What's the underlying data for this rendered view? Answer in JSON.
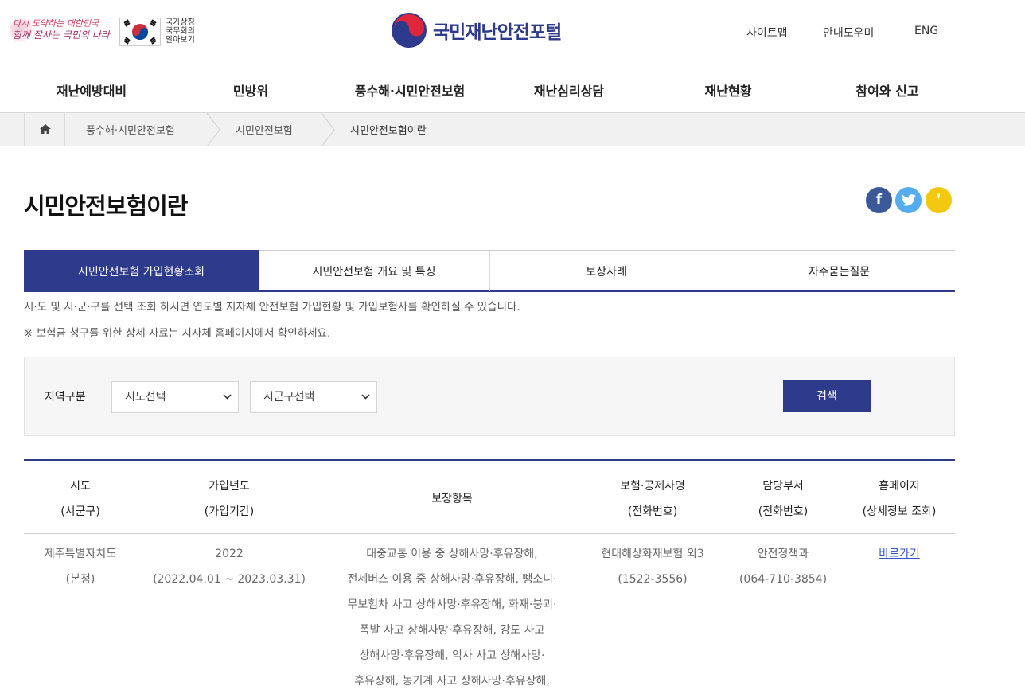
{
  "header": {
    "slogan_line1": "다시 도약하는 대한민국",
    "slogan_line2": "함께 잘사는 국민의 나라",
    "flag_text_line1": "국가상징",
    "flag_text_line2": "국무회의",
    "flag_text_line3": "알아보기",
    "site_name": "국민재난안전포털",
    "util_links": [
      "사이트맵",
      "안내도우미",
      "ENG"
    ]
  },
  "gnb": [
    "재난예방대비",
    "민방위",
    "풍수해·시민안전보험",
    "재난심리상담",
    "재난현황",
    "참여와 신고"
  ],
  "breadcrumb": [
    "풍수해·시민안전보험",
    "시민안전보험",
    "시민안전보험이란"
  ],
  "page_title": "시민안전보험이란",
  "sns": {
    "facebook": "f",
    "kakao": "❜"
  },
  "tabs": [
    "시민안전보험 가입현황조회",
    "시민안전보험 개요 및 특징",
    "보상사례",
    "자주묻는질문"
  ],
  "description": [
    "시·도 및 시·군·구를 선택 조회 하시면 연도별 지자체 안전보험 가입현황 및 가입보험사를 확인하실 수 있습니다.",
    "※ 보험금 청구를 위한 상세 자료는 지자체 홈페이지에서 확인하세요."
  ],
  "search": {
    "label": "지역구분",
    "sido_selected": "시도선택",
    "sigungu_selected": "시군구선택",
    "button": "검색"
  },
  "table": {
    "headers": [
      {
        "line1": "시도",
        "line2": "(시군구)"
      },
      {
        "line1": "가입년도",
        "line2": "(가입기간)"
      },
      {
        "line1": "보장항목",
        "line2": ""
      },
      {
        "line1": "보험·공제사명",
        "line2": "(전화번호)"
      },
      {
        "line1": "담당부서",
        "line2": "(전화번호)"
      },
      {
        "line1": "홈페이지",
        "line2": "(상세정보 조회)"
      }
    ],
    "rows": [
      {
        "sido": "제주특별자치도",
        "sigungu": "(본청)",
        "year": "2022",
        "period": "(2022.04.01 ~ 2023.03.31)",
        "coverage": [
          "대중교통 이용 중 상해사망·후유장해,",
          "전세버스 이용 중 상해사망·후유장해, 뺑소니·",
          "무보험차 사고 상해사망·후유장해, 화재·붕괴·",
          "폭발 사고 상해사망·후유장해, 강도 사고",
          "상해사망·후유장해, 익사 사고 상해사망·",
          "후유장해, 농기계 사고 상해사망·후유장해,"
        ],
        "insurer": "현대해상화재보험 외3",
        "insurer_phone": "(1522-3556)",
        "dept": "안전정책과",
        "dept_phone": "(064-710-3854)",
        "homepage": "바로가기"
      }
    ]
  },
  "colors": {
    "primary": "#2e3a8c",
    "link": "#3355cc",
    "facebook": "#3b5998",
    "twitter": "#55acee",
    "kakao": "#f2c811"
  }
}
